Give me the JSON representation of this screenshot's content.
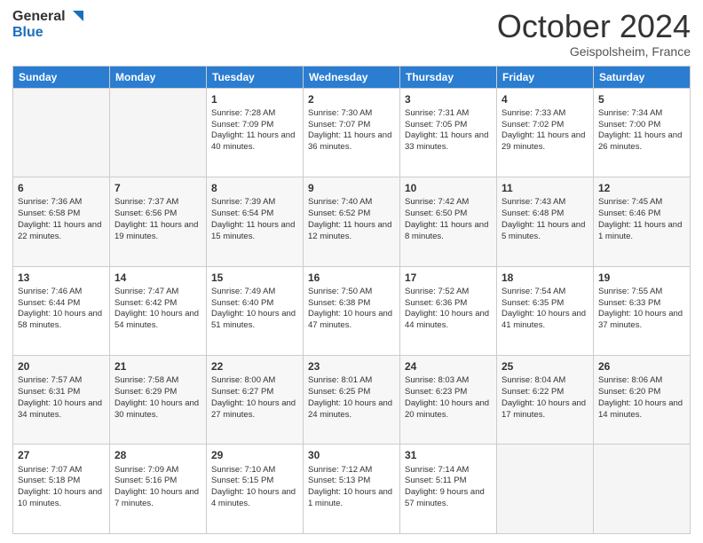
{
  "header": {
    "logo_general": "General",
    "logo_blue": "Blue",
    "month": "October 2024",
    "location": "Geispolsheim, France"
  },
  "days": [
    "Sunday",
    "Monday",
    "Tuesday",
    "Wednesday",
    "Thursday",
    "Friday",
    "Saturday"
  ],
  "weeks": [
    [
      {
        "day": "",
        "sunrise": "",
        "sunset": "",
        "daylight": ""
      },
      {
        "day": "",
        "sunrise": "",
        "sunset": "",
        "daylight": ""
      },
      {
        "day": "1",
        "sunrise": "Sunrise: 7:28 AM",
        "sunset": "Sunset: 7:09 PM",
        "daylight": "Daylight: 11 hours and 40 minutes."
      },
      {
        "day": "2",
        "sunrise": "Sunrise: 7:30 AM",
        "sunset": "Sunset: 7:07 PM",
        "daylight": "Daylight: 11 hours and 36 minutes."
      },
      {
        "day": "3",
        "sunrise": "Sunrise: 7:31 AM",
        "sunset": "Sunset: 7:05 PM",
        "daylight": "Daylight: 11 hours and 33 minutes."
      },
      {
        "day": "4",
        "sunrise": "Sunrise: 7:33 AM",
        "sunset": "Sunset: 7:02 PM",
        "daylight": "Daylight: 11 hours and 29 minutes."
      },
      {
        "day": "5",
        "sunrise": "Sunrise: 7:34 AM",
        "sunset": "Sunset: 7:00 PM",
        "daylight": "Daylight: 11 hours and 26 minutes."
      }
    ],
    [
      {
        "day": "6",
        "sunrise": "Sunrise: 7:36 AM",
        "sunset": "Sunset: 6:58 PM",
        "daylight": "Daylight: 11 hours and 22 minutes."
      },
      {
        "day": "7",
        "sunrise": "Sunrise: 7:37 AM",
        "sunset": "Sunset: 6:56 PM",
        "daylight": "Daylight: 11 hours and 19 minutes."
      },
      {
        "day": "8",
        "sunrise": "Sunrise: 7:39 AM",
        "sunset": "Sunset: 6:54 PM",
        "daylight": "Daylight: 11 hours and 15 minutes."
      },
      {
        "day": "9",
        "sunrise": "Sunrise: 7:40 AM",
        "sunset": "Sunset: 6:52 PM",
        "daylight": "Daylight: 11 hours and 12 minutes."
      },
      {
        "day": "10",
        "sunrise": "Sunrise: 7:42 AM",
        "sunset": "Sunset: 6:50 PM",
        "daylight": "Daylight: 11 hours and 8 minutes."
      },
      {
        "day": "11",
        "sunrise": "Sunrise: 7:43 AM",
        "sunset": "Sunset: 6:48 PM",
        "daylight": "Daylight: 11 hours and 5 minutes."
      },
      {
        "day": "12",
        "sunrise": "Sunrise: 7:45 AM",
        "sunset": "Sunset: 6:46 PM",
        "daylight": "Daylight: 11 hours and 1 minute."
      }
    ],
    [
      {
        "day": "13",
        "sunrise": "Sunrise: 7:46 AM",
        "sunset": "Sunset: 6:44 PM",
        "daylight": "Daylight: 10 hours and 58 minutes."
      },
      {
        "day": "14",
        "sunrise": "Sunrise: 7:47 AM",
        "sunset": "Sunset: 6:42 PM",
        "daylight": "Daylight: 10 hours and 54 minutes."
      },
      {
        "day": "15",
        "sunrise": "Sunrise: 7:49 AM",
        "sunset": "Sunset: 6:40 PM",
        "daylight": "Daylight: 10 hours and 51 minutes."
      },
      {
        "day": "16",
        "sunrise": "Sunrise: 7:50 AM",
        "sunset": "Sunset: 6:38 PM",
        "daylight": "Daylight: 10 hours and 47 minutes."
      },
      {
        "day": "17",
        "sunrise": "Sunrise: 7:52 AM",
        "sunset": "Sunset: 6:36 PM",
        "daylight": "Daylight: 10 hours and 44 minutes."
      },
      {
        "day": "18",
        "sunrise": "Sunrise: 7:54 AM",
        "sunset": "Sunset: 6:35 PM",
        "daylight": "Daylight: 10 hours and 41 minutes."
      },
      {
        "day": "19",
        "sunrise": "Sunrise: 7:55 AM",
        "sunset": "Sunset: 6:33 PM",
        "daylight": "Daylight: 10 hours and 37 minutes."
      }
    ],
    [
      {
        "day": "20",
        "sunrise": "Sunrise: 7:57 AM",
        "sunset": "Sunset: 6:31 PM",
        "daylight": "Daylight: 10 hours and 34 minutes."
      },
      {
        "day": "21",
        "sunrise": "Sunrise: 7:58 AM",
        "sunset": "Sunset: 6:29 PM",
        "daylight": "Daylight: 10 hours and 30 minutes."
      },
      {
        "day": "22",
        "sunrise": "Sunrise: 8:00 AM",
        "sunset": "Sunset: 6:27 PM",
        "daylight": "Daylight: 10 hours and 27 minutes."
      },
      {
        "day": "23",
        "sunrise": "Sunrise: 8:01 AM",
        "sunset": "Sunset: 6:25 PM",
        "daylight": "Daylight: 10 hours and 24 minutes."
      },
      {
        "day": "24",
        "sunrise": "Sunrise: 8:03 AM",
        "sunset": "Sunset: 6:23 PM",
        "daylight": "Daylight: 10 hours and 20 minutes."
      },
      {
        "day": "25",
        "sunrise": "Sunrise: 8:04 AM",
        "sunset": "Sunset: 6:22 PM",
        "daylight": "Daylight: 10 hours and 17 minutes."
      },
      {
        "day": "26",
        "sunrise": "Sunrise: 8:06 AM",
        "sunset": "Sunset: 6:20 PM",
        "daylight": "Daylight: 10 hours and 14 minutes."
      }
    ],
    [
      {
        "day": "27",
        "sunrise": "Sunrise: 7:07 AM",
        "sunset": "Sunset: 5:18 PM",
        "daylight": "Daylight: 10 hours and 10 minutes."
      },
      {
        "day": "28",
        "sunrise": "Sunrise: 7:09 AM",
        "sunset": "Sunset: 5:16 PM",
        "daylight": "Daylight: 10 hours and 7 minutes."
      },
      {
        "day": "29",
        "sunrise": "Sunrise: 7:10 AM",
        "sunset": "Sunset: 5:15 PM",
        "daylight": "Daylight: 10 hours and 4 minutes."
      },
      {
        "day": "30",
        "sunrise": "Sunrise: 7:12 AM",
        "sunset": "Sunset: 5:13 PM",
        "daylight": "Daylight: 10 hours and 1 minute."
      },
      {
        "day": "31",
        "sunrise": "Sunrise: 7:14 AM",
        "sunset": "Sunset: 5:11 PM",
        "daylight": "Daylight: 9 hours and 57 minutes."
      },
      {
        "day": "",
        "sunrise": "",
        "sunset": "",
        "daylight": ""
      },
      {
        "day": "",
        "sunrise": "",
        "sunset": "",
        "daylight": ""
      }
    ]
  ]
}
